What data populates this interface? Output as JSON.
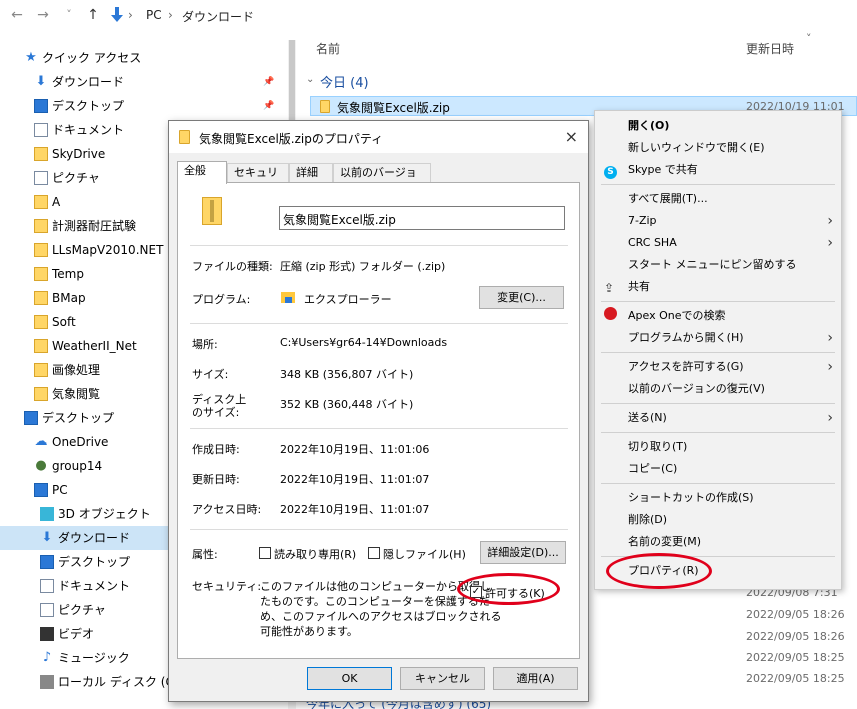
{
  "nav": {
    "back": "←",
    "fwd": "→",
    "recent": "˅",
    "up": "↑",
    "crumb1": "PC",
    "crumb2": "ダウンロード",
    "sep": "›"
  },
  "sidebar": {
    "items": [
      {
        "label": "クイック アクセス",
        "icon": "star-icon",
        "level": 0,
        "pin": false
      },
      {
        "label": "ダウンロード",
        "icon": "download-icon",
        "level": 1,
        "pin": true
      },
      {
        "label": "デスクトップ",
        "icon": "desktop-icon",
        "level": 1,
        "pin": true
      },
      {
        "label": "ドキュメント",
        "icon": "document-icon",
        "level": 1,
        "pin": false
      },
      {
        "label": "SkyDrive",
        "icon": "folder-icon",
        "level": 1,
        "pin": false
      },
      {
        "label": "ピクチャ",
        "icon": "picture-icon",
        "level": 1,
        "pin": false
      },
      {
        "label": "A",
        "icon": "folder-icon",
        "level": 1,
        "pin": false
      },
      {
        "label": "計測器耐圧試験",
        "icon": "folder-icon",
        "level": 1,
        "pin": false
      },
      {
        "label": "LLsMapV2010.NET",
        "icon": "folder-icon",
        "level": 1,
        "pin": false
      },
      {
        "label": "Temp",
        "icon": "folder-icon",
        "level": 1,
        "pin": false
      },
      {
        "label": "BMap",
        "icon": "folder-icon",
        "level": 1,
        "pin": false
      },
      {
        "label": "Soft",
        "icon": "folder-icon",
        "level": 1,
        "pin": false
      },
      {
        "label": "WeatherII_Net",
        "icon": "folder-icon",
        "level": 1,
        "pin": false
      },
      {
        "label": "画像処理",
        "icon": "folder-icon",
        "level": 1,
        "pin": false
      },
      {
        "label": "気象閲覧",
        "icon": "folder-icon",
        "level": 1,
        "pin": false
      },
      {
        "label": "デスクトップ",
        "icon": "desktop-icon",
        "level": 0,
        "pin": false
      },
      {
        "label": "OneDrive",
        "icon": "cloud-icon",
        "level": 1,
        "pin": false
      },
      {
        "label": "group14",
        "icon": "user-icon",
        "level": 1,
        "pin": false
      },
      {
        "label": "PC",
        "icon": "pc-icon",
        "level": 1,
        "pin": false
      },
      {
        "label": "3D オブジェクト",
        "icon": "cube-icon",
        "level": 2,
        "pin": false
      },
      {
        "label": "ダウンロード",
        "icon": "download-icon",
        "level": 2,
        "pin": false,
        "selected": true
      },
      {
        "label": "デスクトップ",
        "icon": "desktop-icon",
        "level": 2,
        "pin": false
      },
      {
        "label": "ドキュメント",
        "icon": "document-icon",
        "level": 2,
        "pin": false
      },
      {
        "label": "ピクチャ",
        "icon": "picture-icon",
        "level": 2,
        "pin": false
      },
      {
        "label": "ビデオ",
        "icon": "video-icon",
        "level": 2,
        "pin": false
      },
      {
        "label": "ミュージック",
        "icon": "music-icon",
        "level": 2,
        "pin": false
      },
      {
        "label": "ローカル ディスク (C:)",
        "icon": "drive-icon",
        "level": 2,
        "pin": false
      }
    ]
  },
  "list": {
    "col_name": "名前",
    "col_date": "更新日時",
    "sort": "˅",
    "group_today": "今日 (4)",
    "file_name": "気象閲覧Excel版.zip",
    "file_date": "2022/10/19 11:01",
    "dates": [
      "2022/09/08 7:31",
      "2022/09/05 18:26",
      "2022/09/05 18:26",
      "2022/09/05 18:25",
      "2022/09/05 18:25"
    ],
    "group_month": "今年に入って (今月は含めず) (65)"
  },
  "dialog": {
    "title": "気象閲覧Excel版.zipのプロパティ",
    "close": "×",
    "tabs": [
      "全般",
      "セキュリティ",
      "詳細",
      "以前のバージョン"
    ],
    "filename": "気象閲覧Excel版.zip",
    "type_label": "ファイルの種類:",
    "type_value": "圧縮 (zip 形式) フォルダー (.zip)",
    "prog_label": "プログラム:",
    "prog_value": "エクスプローラー",
    "change_btn": "変更(C)...",
    "loc_label": "場所:",
    "loc_value": "C:¥Users¥gr64-14¥Downloads",
    "size_label": "サイズ:",
    "size_value": "348 KB (356,807 バイト)",
    "disk_label1": "ディスク上",
    "disk_label2": "のサイズ:",
    "disk_value": "352 KB (360,448 バイト)",
    "created_label": "作成日時:",
    "created_value": "2022年10月19日、11:01:06",
    "modified_label": "更新日時:",
    "modified_value": "2022年10月19日、11:01:07",
    "accessed_label": "アクセス日時:",
    "accessed_value": "2022年10月19日、11:01:07",
    "attr_label": "属性:",
    "readonly": "読み取り専用(R)",
    "hidden": "隠しファイル(H)",
    "advanced_btn": "詳細設定(D)...",
    "sec_label": "セキュリティ:",
    "sec_text1": "このファイルは他のコンピューターから取得し",
    "sec_text2": "たものです。このコンピューターを保護するた",
    "sec_text3": "め、このファイルへのアクセスはブロックされる",
    "sec_text4": "可能性があります。",
    "unblock": "許可する(K)",
    "ok": "OK",
    "cancel": "キャンセル",
    "apply": "適用(A)"
  },
  "menu": {
    "items": [
      {
        "label": "開く(O)",
        "bold": true
      },
      {
        "label": "新しいウィンドウで開く(E)"
      },
      {
        "label": "Skype で共有",
        "icon": "skype-icon"
      },
      {
        "sep": true
      },
      {
        "label": "すべて展開(T)..."
      },
      {
        "label": "7-Zip",
        "arrow": true
      },
      {
        "label": "CRC SHA",
        "arrow": true
      },
      {
        "label": "スタート メニューにピン留めする"
      },
      {
        "label": "共有",
        "icon": "share-icon"
      },
      {
        "sep": true
      },
      {
        "label": "Apex Oneでの検索",
        "icon": "apex-icon"
      },
      {
        "label": "プログラムから開く(H)",
        "arrow": true
      },
      {
        "sep": true
      },
      {
        "label": "アクセスを許可する(G)",
        "arrow": true
      },
      {
        "label": "以前のバージョンの復元(V)"
      },
      {
        "sep": true
      },
      {
        "label": "送る(N)",
        "arrow": true
      },
      {
        "sep": true
      },
      {
        "label": "切り取り(T)"
      },
      {
        "label": "コピー(C)"
      },
      {
        "sep": true
      },
      {
        "label": "ショートカットの作成(S)"
      },
      {
        "label": "削除(D)"
      },
      {
        "label": "名前の変更(M)"
      },
      {
        "sep": true
      },
      {
        "label": "プロパティ(R)"
      }
    ],
    "arrow": "›"
  }
}
